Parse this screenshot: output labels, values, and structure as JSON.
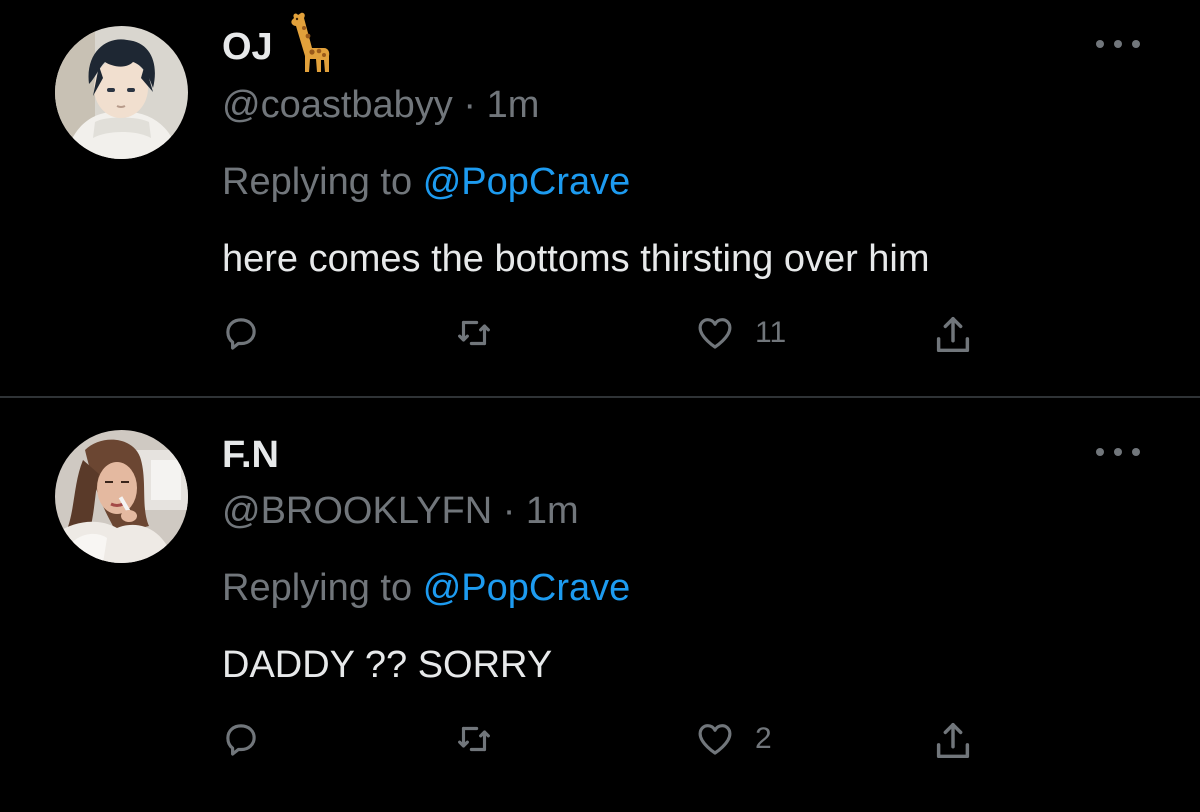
{
  "tweets": [
    {
      "display_name": "OJ",
      "name_emoji": "giraffe-emoji",
      "handle": "@coastbabyy",
      "separator": "·",
      "time": "1m",
      "replying_prefix": "Replying to",
      "replying_to": "@PopCrave",
      "text": "here comes the bottoms thirsting over him",
      "reply_count": "",
      "retweet_count": "",
      "like_count": "11",
      "icons": {
        "more": "more-icon",
        "reply": "reply-icon",
        "retweet": "retweet-icon",
        "like": "heart-icon",
        "share": "share-icon"
      }
    },
    {
      "display_name": "F.N",
      "handle": "@BROOKLYFN",
      "separator": "·",
      "time": "1m",
      "replying_prefix": "Replying to",
      "replying_to": "@PopCrave",
      "text": "DADDY ?? SORRY",
      "reply_count": "",
      "retweet_count": "",
      "like_count": "2",
      "icons": {
        "more": "more-icon",
        "reply": "reply-icon",
        "retweet": "retweet-icon",
        "like": "heart-icon",
        "share": "share-icon"
      }
    }
  ],
  "colors": {
    "background": "#000000",
    "primary_text": "#e7e9ea",
    "secondary_text": "#71767b",
    "link": "#1d9bf0",
    "divider": "#2f3336"
  }
}
